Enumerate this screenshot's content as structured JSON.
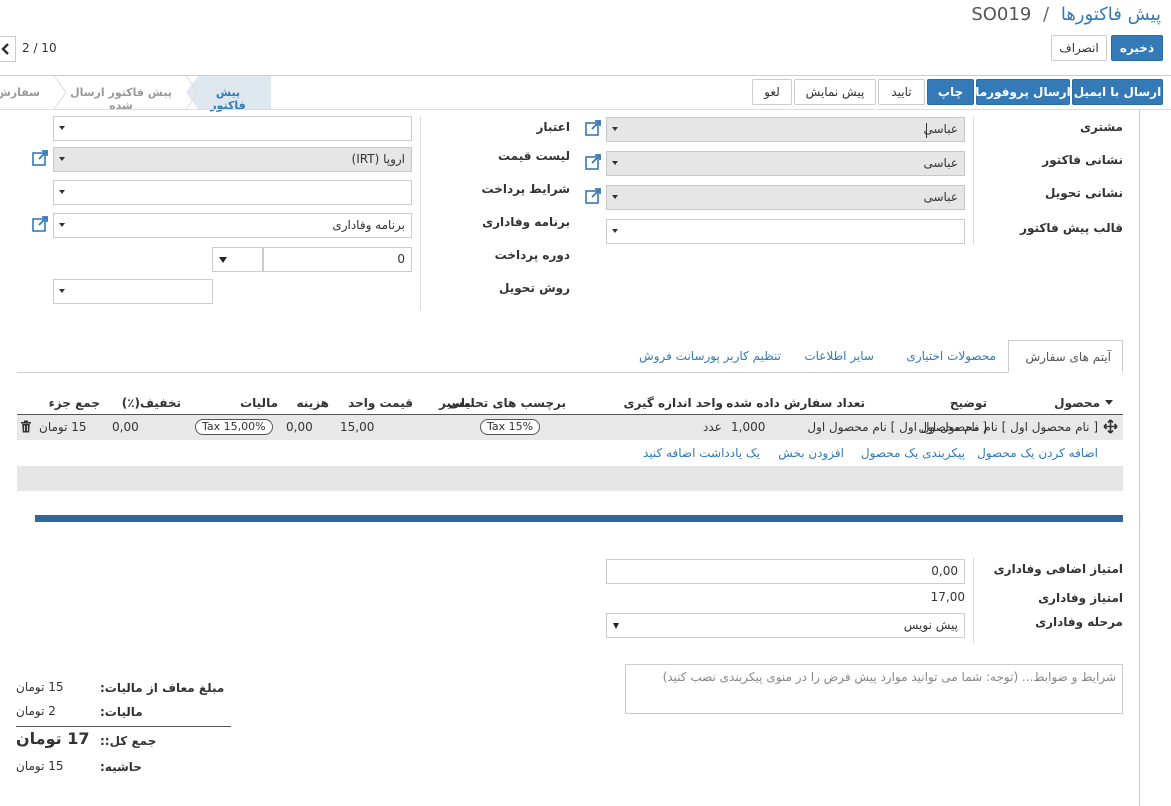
{
  "header": {
    "breadcrumb_parent": "پیش فاکتورها",
    "breadcrumb_sep": "/",
    "record_name": "SO019",
    "save_label": "ذخیره",
    "discard_label": "انصراف",
    "pager": "2 / 10"
  },
  "actions": {
    "send_email": "ارسال با ایمیل",
    "send_proforma": "ارسال پروفورما",
    "print": "چاپ",
    "confirm": "تایید",
    "preview": "پیش نمایش",
    "cancel": "لغو"
  },
  "statusbar": {
    "steps": [
      "پیش فاکتور",
      "پیش فاکتور ارسال شده",
      "سفارش ف"
    ],
    "active_index": 0
  },
  "form_right": {
    "customer_label": "مشتری",
    "customer_value": "عباسی",
    "invoice_addr_label": "نشانی فاکتور",
    "invoice_addr_value": "عباسی",
    "delivery_addr_label": "نشانی تحویل",
    "delivery_addr_value": "عباسی",
    "template_label": "قالب پیش فاکتور",
    "template_value": ""
  },
  "form_left": {
    "validity_label": "اعتبار",
    "validity_value": "",
    "pricelist_label": "لیست قیمت",
    "pricelist_value": "اروپا (IRT)",
    "payment_terms_label": "شرایط پرداخت",
    "payment_terms_value": "",
    "loyalty_label": "برنامه وفاداری",
    "loyalty_value": "برنامه وفاداری",
    "payment_period_label": "دوره پرداخت",
    "payment_period_value": "0",
    "delivery_method_label": "روش تحویل",
    "delivery_method_value": ""
  },
  "tabs": [
    "آیتم های سفارش",
    "محصولات اختیاری",
    "سایر اطلاعات",
    "تنظیم کاربر پورسانت فروش"
  ],
  "active_tab": 0,
  "table": {
    "columns": [
      "محصول",
      "توضیح",
      "تعداد سفارش داده شده",
      "واحد اندازه گیری",
      "برچسب های تحلیلی",
      "مسیر",
      "قیمت واحد",
      "هزینه",
      "مالیات",
      "تخفیف(٪)",
      "جمع جزء"
    ],
    "rows": [
      {
        "product": "[ نام محصول اول ] نام محصول اول",
        "description": "[ نام محصول اول ] نام محصول اول",
        "qty": "1,000",
        "uom": "عدد",
        "analytic_tag": "Tax 15%",
        "route": "",
        "unit_price": "15,00",
        "cost": "0,00",
        "tax": "Tax 15,00%",
        "discount": "0,00",
        "subtotal": "15 تومان"
      }
    ],
    "add_product": "اضافه کردن یک محصول",
    "configure_product": "پیکربندی یک محصول",
    "add_section": "افزودن بخش",
    "add_note": "یک یادداشت اضافه کنید"
  },
  "loyalty": {
    "extra_points_label": "امتیاز اضافی وفاداری",
    "extra_points_value": "0,00",
    "points_label": "امتیاز وفاداری",
    "points_value": "17,00",
    "stage_label": "مرحله وفاداری",
    "stage_value": "پیش نویس"
  },
  "terms_placeholder": "شرایط و ضوابط... (توجه: شما می توانید موارد پیش فرض را در منوی پیکربندی نصب کنید)",
  "totals": {
    "untaxed_label": "مبلغ معاف از مالیات:",
    "untaxed_value": "15 تومان",
    "taxes_label": "مالیات:",
    "taxes_value": "2 تومان",
    "total_label": "جمع کل::",
    "total_value": "17 تومان",
    "margin_label": "حاشیه:",
    "margin_value": "15 تومان"
  }
}
